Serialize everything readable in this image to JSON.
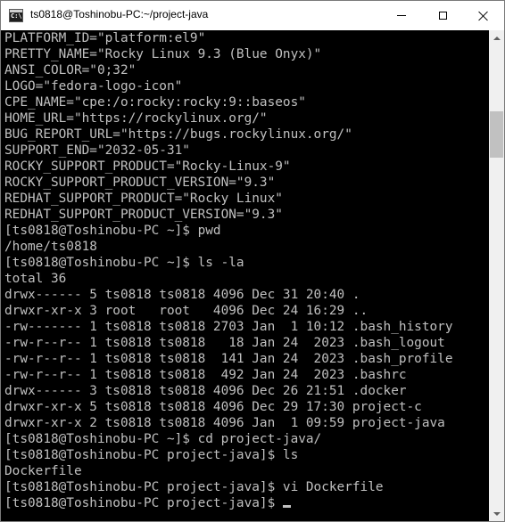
{
  "window": {
    "title": "ts0818@Toshinobu-PC:~/project-java",
    "app_icon_glyph": "C:\\"
  },
  "terminal": {
    "lines": [
      "PLATFORM_ID=\"platform:el9\"",
      "PRETTY_NAME=\"Rocky Linux 9.3 (Blue Onyx)\"",
      "ANSI_COLOR=\"0;32\"",
      "LOGO=\"fedora-logo-icon\"",
      "CPE_NAME=\"cpe:/o:rocky:rocky:9::baseos\"",
      "HOME_URL=\"https://rockylinux.org/\"",
      "BUG_REPORT_URL=\"https://bugs.rockylinux.org/\"",
      "SUPPORT_END=\"2032-05-31\"",
      "ROCKY_SUPPORT_PRODUCT=\"Rocky-Linux-9\"",
      "ROCKY_SUPPORT_PRODUCT_VERSION=\"9.3\"",
      "REDHAT_SUPPORT_PRODUCT=\"Rocky Linux\"",
      "REDHAT_SUPPORT_PRODUCT_VERSION=\"9.3\"",
      "[ts0818@Toshinobu-PC ~]$ pwd",
      "/home/ts0818",
      "[ts0818@Toshinobu-PC ~]$ ls -la",
      "total 36",
      "drwx------ 5 ts0818 ts0818 4096 Dec 31 20:40 .",
      "drwxr-xr-x 3 root   root   4096 Dec 24 16:29 ..",
      "-rw------- 1 ts0818 ts0818 2703 Jan  1 10:12 .bash_history",
      "-rw-r--r-- 1 ts0818 ts0818   18 Jan 24  2023 .bash_logout",
      "-rw-r--r-- 1 ts0818 ts0818  141 Jan 24  2023 .bash_profile",
      "-rw-r--r-- 1 ts0818 ts0818  492 Jan 24  2023 .bashrc",
      "drwx------ 3 ts0818 ts0818 4096 Dec 26 21:51 .docker",
      "drwxr-xr-x 5 ts0818 ts0818 4096 Dec 29 17:30 project-c",
      "drwxr-xr-x 2 ts0818 ts0818 4096 Jan  1 09:59 project-java",
      "[ts0818@Toshinobu-PC ~]$ cd project-java/",
      "[ts0818@Toshinobu-PC project-java]$ ls",
      "Dockerfile",
      "[ts0818@Toshinobu-PC project-java]$ vi Dockerfile",
      "[ts0818@Toshinobu-PC project-java]$ "
    ]
  },
  "icons": {
    "app": "console-app-icon",
    "minimize": "minimize-icon",
    "maximize": "maximize-icon",
    "close": "close-icon",
    "scroll_up": "scroll-up-arrow-icon",
    "scroll_down": "scroll-down-arrow-icon"
  },
  "scrollbar": {
    "position_fraction": 0.16
  },
  "colors": {
    "console_bg": "#000000",
    "console_fg": "#c0c0c0",
    "titlebar_bg": "#ffffff",
    "scrollbar_bg": "#f0f0f0",
    "scrollbar_thumb": "#c1c1c1"
  }
}
